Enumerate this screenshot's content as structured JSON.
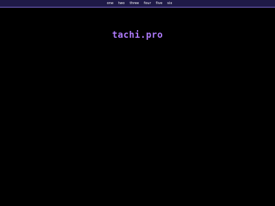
{
  "nav": {
    "items": [
      {
        "label": "one"
      },
      {
        "label": "two"
      },
      {
        "label": "three"
      },
      {
        "label": "four"
      },
      {
        "label": "five"
      },
      {
        "label": "six"
      }
    ]
  },
  "site": {
    "title": "tachi.pro"
  },
  "colors": {
    "background": "#000000",
    "topbar": "#1f1a47",
    "topbar_border": "#7f6bd8",
    "nav_text": "#ffffff",
    "title_text": "#b17cff"
  }
}
